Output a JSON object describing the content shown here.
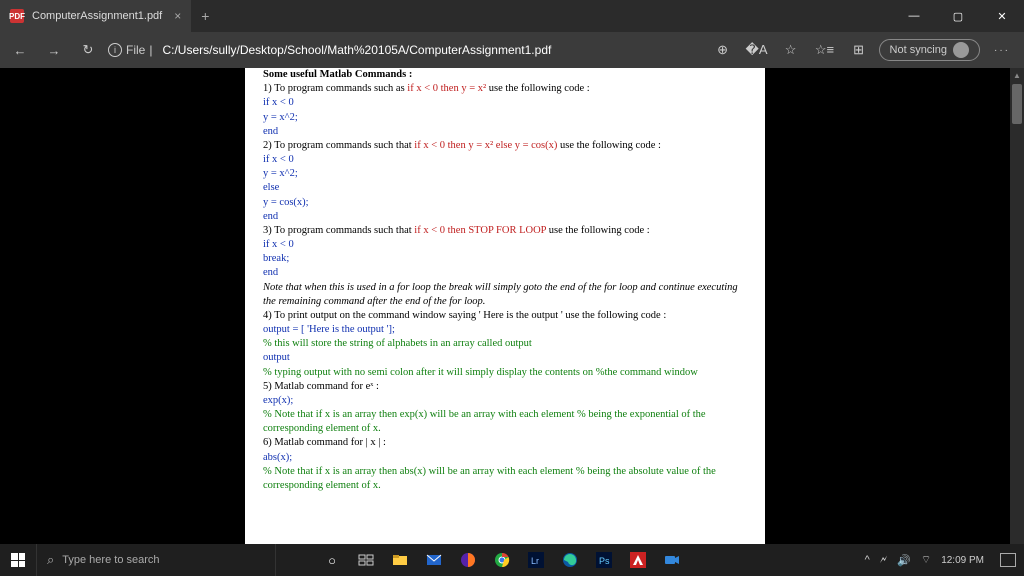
{
  "titlebar": {
    "tab_title": "ComputerAssignment1.pdf",
    "tab_close": "×",
    "tab_add": "+",
    "min": "—",
    "max": "▢",
    "close": "✕"
  },
  "toolbar": {
    "back": "←",
    "fwd": "→",
    "reload": "↻",
    "info": "i",
    "url_prefix": "File",
    "url": "C:/Users/sully/Desktop/School/Math%20105A/ComputerAssignment1.pdf",
    "zoom": "⊕",
    "read": "�A",
    "fav": "☆",
    "favlist": "☆≡",
    "collections": "⊞",
    "sync": "Not syncing",
    "dots": "···"
  },
  "doc": {
    "header": "Some useful Matlab Commands :",
    "l1a": "1) To program commands such as ",
    "l1b": "if x < 0 then y = x²",
    "l1c": " use the following code :",
    "l2": "if x < 0",
    "l3": "y = x^2;",
    "l4": "end",
    "l5a": "2) To program commands such that ",
    "l5b": "if x < 0 then y = x² else y = cos(x)",
    "l5c": " use the following code :",
    "l6": "if x < 0",
    "l7": "y = x^2;",
    "l8": "else",
    "l9": "y = cos(x);",
    "l10": "end",
    "l11a": "3) To program commands such that ",
    "l11b": " if x < 0 then STOP FOR LOOP",
    "l11c": " use the following code :",
    "l12": "if x < 0",
    "l13": "break;",
    "l14": "end",
    "note1": "Note that when this is used in a for loop the break will simply goto the end of the for loop and continue executing the remaining command after the end of the for loop.",
    "l15": "4) To print output on the command window saying ' Here is the output ' use the following code :",
    "l16": "output = [ 'Here is the output '];",
    "l17": "% this will store the string of alphabets in an array called output",
    "l18": "output",
    "l19": "% typing output with no semi colon after it will simply display the contents on %the command window",
    "l20": "5) Matlab command for eˣ :",
    "l21": "exp(x);",
    "l22": "% Note that if x is an array then exp(x) will be an array with each element % being the exponential of the corresponding element of x.",
    "l23": "6) Matlab command for | x | :",
    "l24": "abs(x);",
    "l25": "% Note that if x is an array then abs(x) will be an array with each element % being the absolute value of the corresponding element of x."
  },
  "taskbar": {
    "search_placeholder": "Type here to search",
    "cortana": "○",
    "taskview": "⊞",
    "time": "12:09 PM",
    "chev": "^",
    "bat": "🗲",
    "vol": "🔊",
    "wifi": "⌔"
  }
}
